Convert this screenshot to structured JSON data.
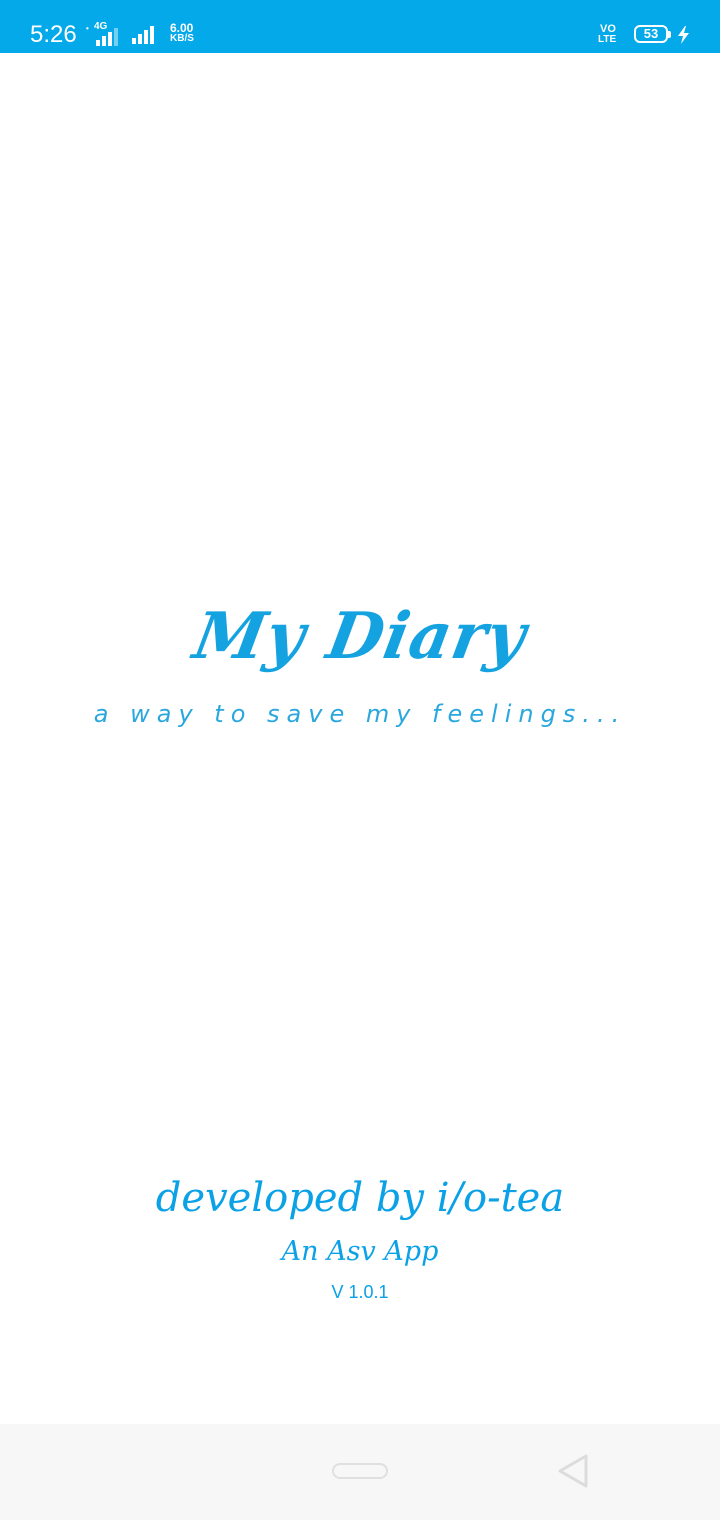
{
  "status_bar": {
    "time": "5:26",
    "network_1": "4G",
    "speed_value": "6.00",
    "speed_unit": "KB/S",
    "volte_top": "VO",
    "volte_bottom": "LTE",
    "battery_level": "53",
    "icons": [
      "signal-icon",
      "signal-icon",
      "volte-icon",
      "battery-icon",
      "charging-icon"
    ],
    "color": "#03a9e8"
  },
  "splash": {
    "app_title": "My Diary",
    "tagline": "a way to save my feelings...",
    "developer_text": "developed by i/o-tea",
    "brand_text": "An Asv App",
    "version": "V 1.0.1",
    "accent_color": "#0aa1e6"
  },
  "nav_bar": {
    "icons": [
      "home-pill-icon",
      "back-icon"
    ]
  }
}
